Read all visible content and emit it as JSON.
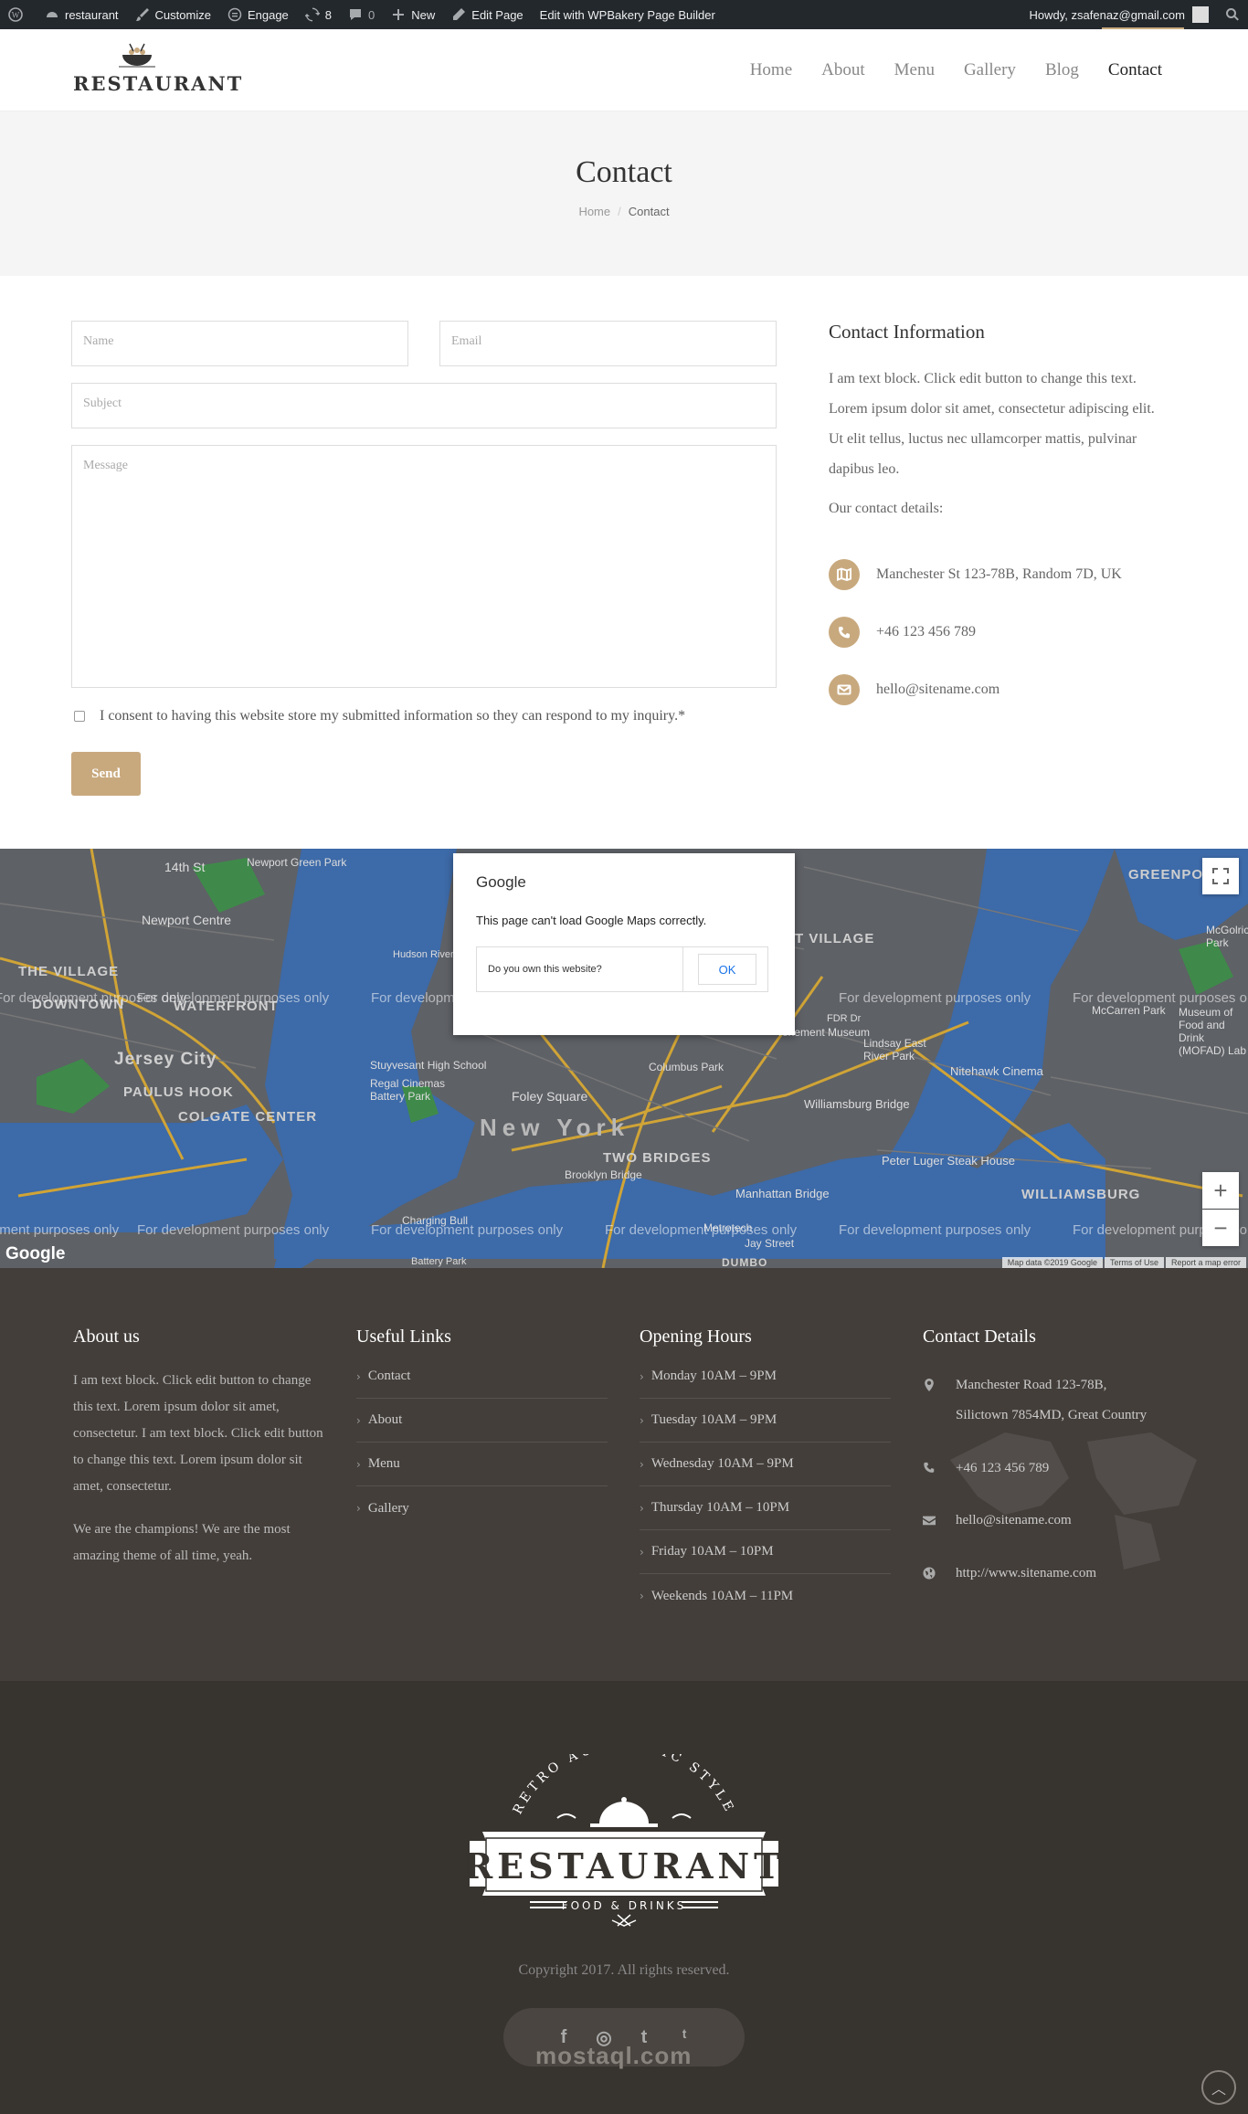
{
  "admin_bar": {
    "site_name": "restaurant",
    "customize": "Customize",
    "engage": "Engage",
    "updates_count": "8",
    "comments_count": "0",
    "new_label": "New",
    "edit_page": "Edit Page",
    "wpbakery": "Edit with WPBakery Page Builder",
    "howdy": "Howdy, zsafenaz@gmail.com"
  },
  "header": {
    "logo_text": "RESTAURANT",
    "nav": [
      "Home",
      "About",
      "Menu",
      "Gallery",
      "Blog",
      "Contact"
    ],
    "active_nav": "Contact"
  },
  "page_title": {
    "title": "Contact",
    "breadcrumb_home": "Home",
    "breadcrumb_current": "Contact"
  },
  "form": {
    "name_placeholder": "Name",
    "email_placeholder": "Email",
    "subject_placeholder": "Subject",
    "message_placeholder": "Message",
    "consent": "I consent to having this website store my submitted information so they can respond to my inquiry.*",
    "send_label": "Send"
  },
  "contact_info": {
    "heading": "Contact Information",
    "text": "I am text block. Click edit button to change this text. Lorem ipsum dolor sit amet, consectetur adipiscing elit. Ut elit tellus, luctus nec ullamcorper mattis, pulvinar dapibus leo.",
    "subheading": "Our contact details:",
    "address": "Manchester St 123-78B, Random 7D, UK",
    "phone": "+46 123 456 789",
    "email": "hello@sitename.com",
    "accent_color": "#c8a97e"
  },
  "map": {
    "dialog_brand": "Google",
    "dialog_message": "This page can't load Google Maps correctly.",
    "own_question": "Do you own this website?",
    "ok_label": "OK",
    "dev_watermark": "For development purposes only",
    "google_logo": "Google",
    "attribution": [
      "Map data ©2019 Google",
      "Terms of Use",
      "Report a map error"
    ],
    "labels": {
      "l1": "14th St",
      "l2": "Newport Green Park",
      "l3": "Newport Centre",
      "l4": "THE VILLAGE",
      "l5": "DOWNTOWN",
      "l6": "WATERFRONT",
      "l7": "Jersey City",
      "l8": "PAULUS HOOK",
      "l9": "COLGATE CENTER",
      "l10": "New York",
      "l11": "TWO BRIDGES",
      "l12": "Foley Square",
      "l13": "Stuyvesant High School",
      "l14": "Regal Cinemas Battery Park",
      "l15": "Columbus Park",
      "l16": "Tenement Museum",
      "l17": "Lindsay East River Park",
      "l18": "Nitehawk Cinema",
      "l19": "Williamsburg Bridge",
      "l20": "WILLIAMSBURG",
      "l21": "GREENPOINT",
      "l22": "Manhattan Bridge",
      "l23": "Brooklyn Bridge",
      "l24": "Peter Luger Steak House",
      "l25": "Museum of Food and Drink (MOFAD) Lab",
      "l26": "McGolrick Park",
      "l27": "McCarren Park",
      "l28": "T VILLAGE",
      "l29": "Battery Park",
      "l30": "DUMBO",
      "l31": "Charging Bull",
      "l32": "Jay Street",
      "l33": "Metrotech",
      "l34": "FDR Dr",
      "l35": "Hudson River Greenway"
    }
  },
  "footer": {
    "about": {
      "heading": "About us",
      "text1": "I am text block. Click edit button to change this text. Lorem ipsum dolor sit amet, consectetur. I am text block. Click edit button to change this text. Lorem ipsum dolor sit amet, consectetur.",
      "text2": "We are the champions! We are the most amazing theme of all time, yeah."
    },
    "links": {
      "heading": "Useful Links",
      "items": [
        "Contact",
        "About",
        "Menu",
        "Gallery"
      ]
    },
    "hours": {
      "heading": "Opening Hours",
      "items": [
        "Monday 10AM – 9PM",
        "Tuesday 10AM – 9PM",
        "Wednesday 10AM – 9PM",
        "Thursday 10AM – 10PM",
        "Friday 10AM – 10PM",
        "Weekends 10AM – 11PM"
      ]
    },
    "details": {
      "heading": "Contact Details",
      "address": "Manchester Road 123-78B, Silictown 7854MD, Great Country",
      "phone": "+46 123 456 789",
      "email": "hello@sitename.com",
      "website": "http://www.sitename.com"
    }
  },
  "bottom": {
    "badge_top": "RETRO AUTHENTIC STYLE",
    "badge_main": "RESTAURANT",
    "badge_sub": "FOOD & DRINKS",
    "copyright": "Copyright 2017. All rights reserved.",
    "social": [
      "f",
      "◎",
      "t",
      "ᵗ"
    ],
    "watermark": "mostaql.com"
  }
}
